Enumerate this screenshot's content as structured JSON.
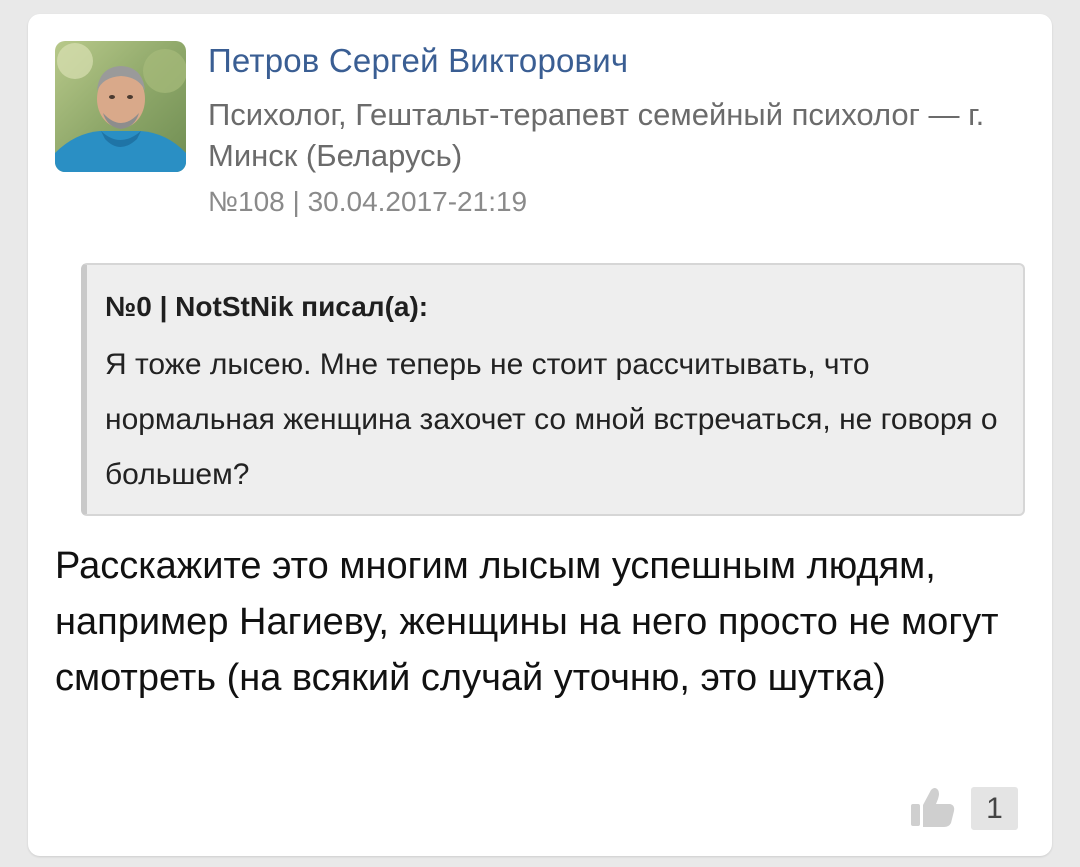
{
  "author": {
    "name": "Петров Сергей Викторович",
    "role": "Психолог, Гештальт-терапевт семейный психолог — г. Минск (Беларусь)",
    "meta": "№108 | 30.04.2017-21:19",
    "avatar": "avatar-photo"
  },
  "quote": {
    "header": "№0 | NotStNik писал(а):",
    "text": "Я тоже лысею. Мне теперь не стоит рассчитывать, что нормальная женщина захочет со мной встречаться, не говоря о большем?"
  },
  "post": {
    "body": "Расскажите это многим лысым успешным людям, например Нагиеву, женщины на него просто не могут смотреть (на всякий случай уточню, это шутка)"
  },
  "like": {
    "icon": "thumbs-up-icon",
    "count": "1"
  },
  "colors": {
    "author_name": "#3a5e93",
    "meta_text": "#8a8a8a",
    "quote_background": "#eeeeee"
  }
}
